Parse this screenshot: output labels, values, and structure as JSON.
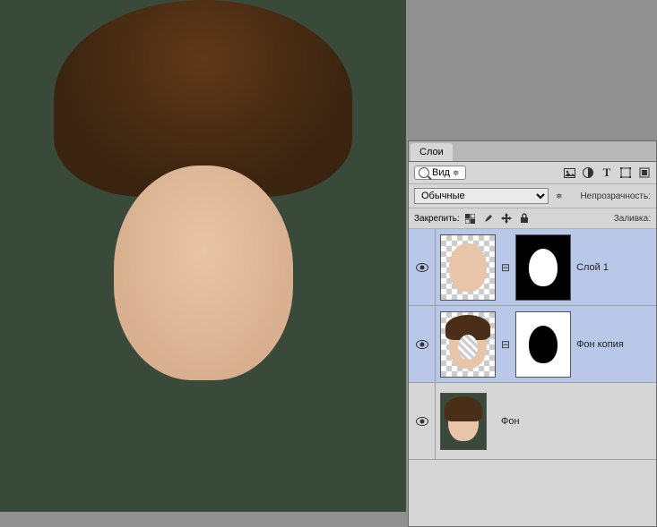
{
  "panel": {
    "tab_label": "Слои",
    "search_label": "Вид",
    "blend_mode": "Обычные",
    "opacity_label": "Непрозрачность:",
    "lock_label": "Закрепить:",
    "fill_label": "Заливка:"
  },
  "filter_icons": {
    "image": "image-filter-icon",
    "adjust": "adjust-filter-icon",
    "text": "text-filter-icon",
    "shape": "shape-filter-icon",
    "smart": "smart-filter-icon"
  },
  "lock_icons": {
    "pixels": "lock-pixels-icon",
    "brush": "lock-brush-icon",
    "move": "lock-move-icon",
    "all": "lock-all-icon"
  },
  "layers": [
    {
      "name": "Слой 1",
      "visible": true,
      "has_mask": true,
      "mask_inverted": false,
      "selected": true,
      "thumb": "face-cut"
    },
    {
      "name": "Фон копия",
      "visible": true,
      "has_mask": true,
      "mask_inverted": true,
      "selected": true,
      "thumb": "face-hole"
    },
    {
      "name": "Фон",
      "visible": true,
      "has_mask": false,
      "mask_inverted": false,
      "selected": false,
      "thumb": "face-full"
    }
  ]
}
